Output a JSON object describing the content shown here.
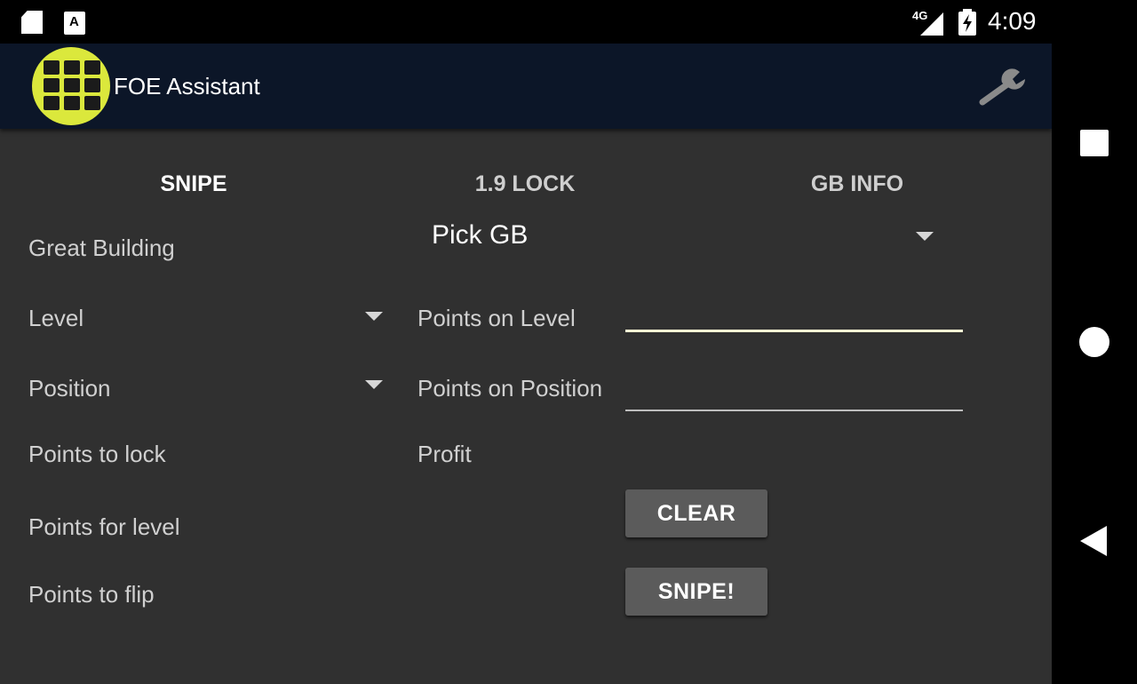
{
  "status_bar": {
    "network": "4G",
    "time": "4:09",
    "icons": [
      "sd-card-icon",
      "a-notification-icon",
      "signal-icon",
      "battery-charging-icon"
    ]
  },
  "app_bar": {
    "title": "FOE Assistant",
    "logo_icon": "grid-logo-icon",
    "settings_icon": "wrench-icon",
    "logo_color": "#dbe83c",
    "background": "#0c1628"
  },
  "tabs": [
    {
      "label": "SNIPE",
      "selected": true
    },
    {
      "label": "1.9 LOCK",
      "selected": false
    },
    {
      "label": "GB INFO",
      "selected": false
    }
  ],
  "form": {
    "great_building_label": "Great Building",
    "great_building_value": "Pick GB",
    "level_label": "Level",
    "position_label": "Position",
    "points_to_lock_label": "Points to lock",
    "points_for_level_label": "Points for level",
    "points_to_flip_label": "Points to flip",
    "points_on_level_label": "Points on Level",
    "points_on_level_value": "",
    "points_on_position_label": "Points on Position",
    "points_on_position_value": "",
    "profit_label": "Profit"
  },
  "buttons": {
    "clear": "CLEAR",
    "snipe": "SNIPE!"
  },
  "nav_bar": {
    "icons": [
      "recent-apps-icon",
      "home-icon",
      "back-icon"
    ]
  }
}
